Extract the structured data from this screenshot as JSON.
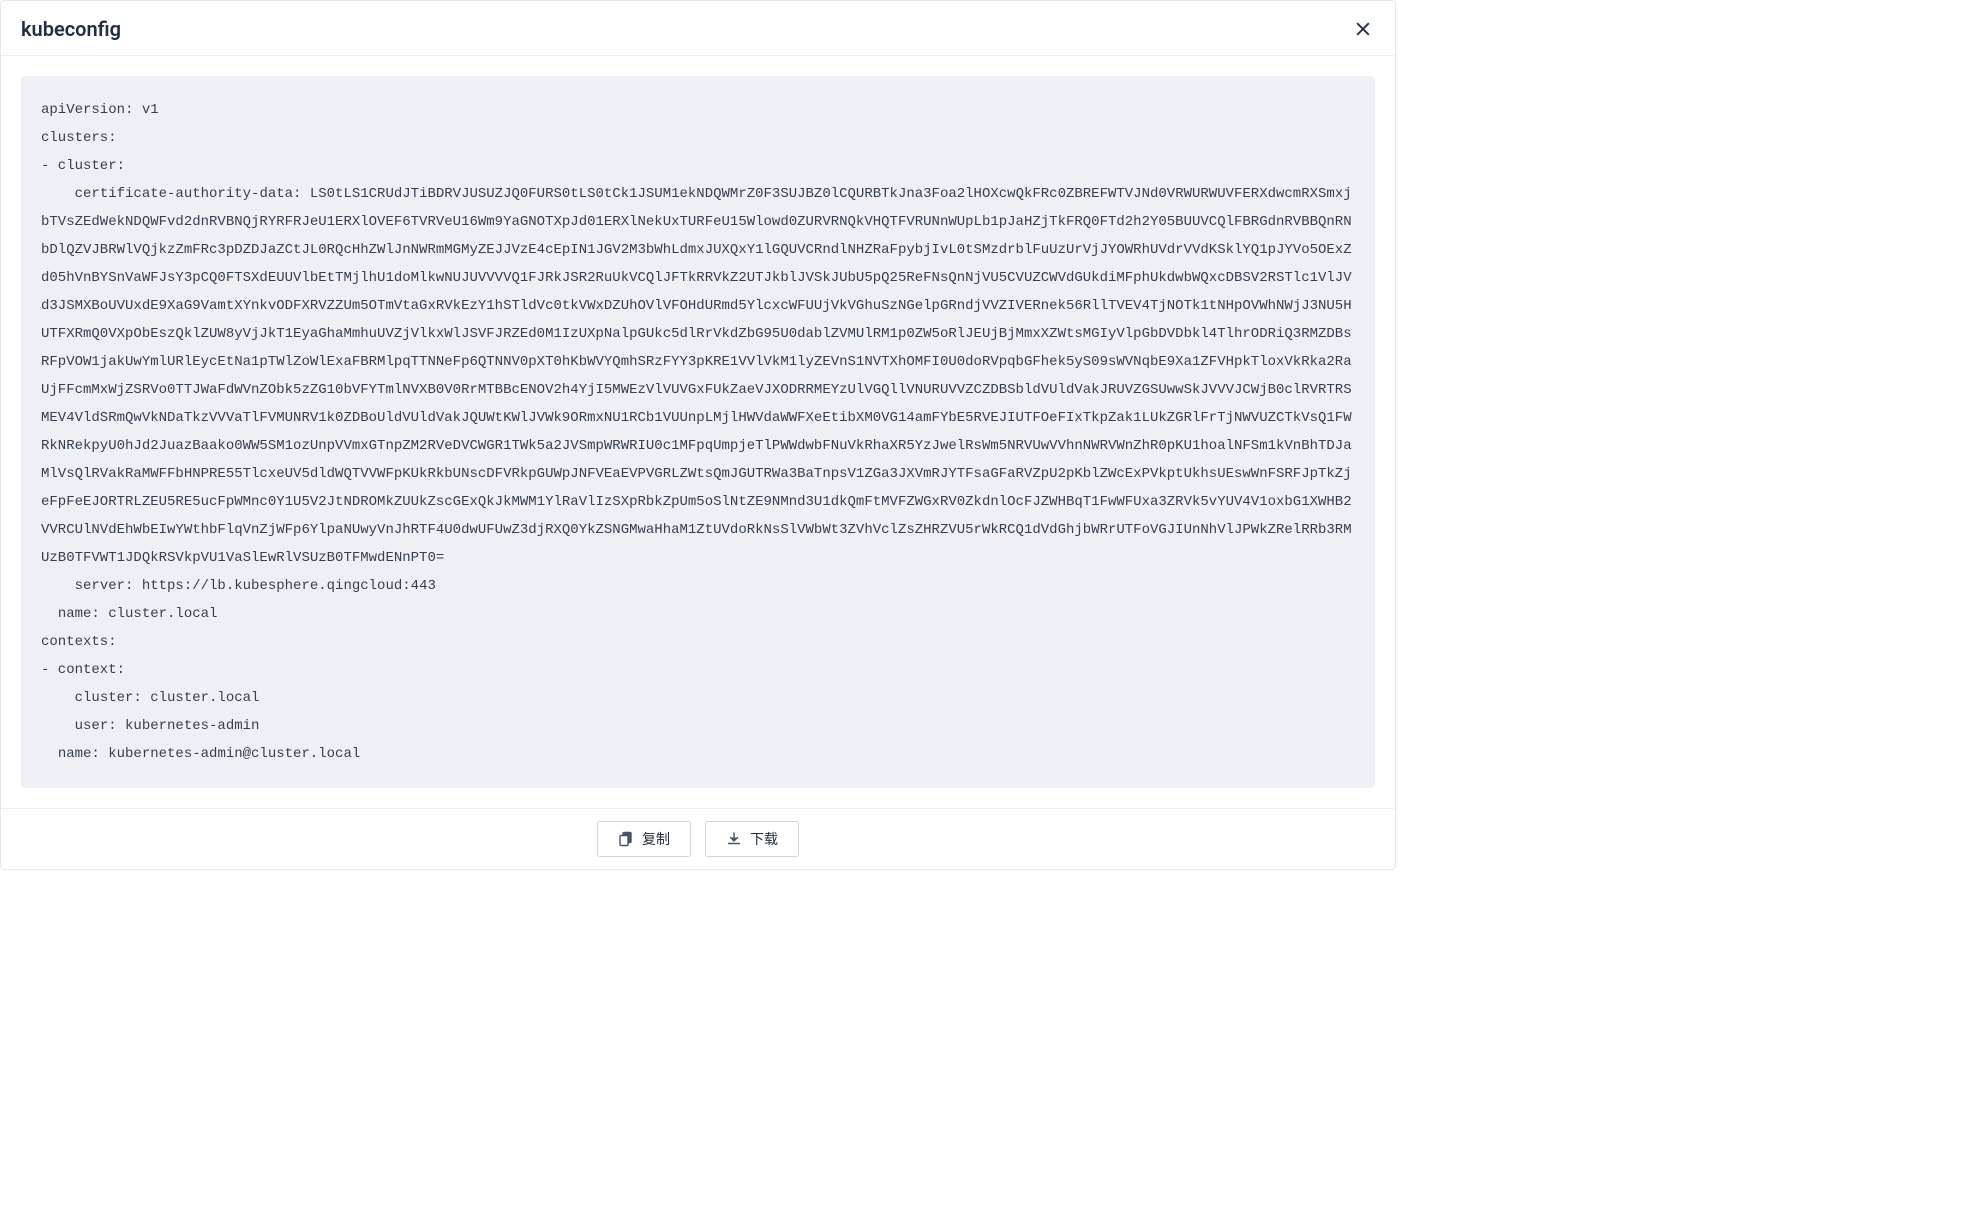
{
  "modal": {
    "title": "kubeconfig",
    "code": "apiVersion: v1\nclusters:\n- cluster:\n    certificate-authority-data: LS0tLS1CRUdJTiBDRVJUSUZJQ0FURS0tLS0tCk1JSUM1ekNDQWMrZ0F3SUJBZ0lCQURBTkJna3Foa2lHOXcwQkFRc0ZBREFWTVJNd0VRWURWUVFERXdwcmRXSmxjbTVsZEdWekNDQWFvd2dnRVBNQjRYRFRJeU1ERXlOVEF6TVRVeU16Wm9YaGNOTXpJd01ERXlNekUxTURFeU15Wlowd0ZURVRNQkVHQTFVRUNnWUpLb1pJaHZjTkFRQ0FTd2h2Y05BUUVCQlFBRGdnRVBBQnRNbDlQZVJBRWlVQjkzZmFRc3pDZDJaZCtJL0RQcHhZWlJnNWRmMGMyZEJJVzE4cEpIN1JGV2M3bWhLdmxJUXQxY1lGQUVCRndlNHZRaFpybjIvL0tSMzdrblFuUzUrVjJYOWRhUVdrVVdKSklYQ1pJYVo5OExZd05hVnBYSnVaWFJsY3pCQ0FTSXdEUUVlbEtTMjlhU1doMlkwNUJUVVVVQ1FJRkJSR2RuUkVCQlJFTkRRVkZ2UTJkblJVSkJUbU5pQ25ReFNsQnNjVU5CVUZCWVdGUkdiMFphUkdwbWQxcDBSV2RSTlc1VlJVd3JSMXBoUVUxdE9XaG9VamtXYnkvODFXRVZZUm5OTmVtaGxRVkEzY1hSTldVc0tkVWxDZUhOVlVFOHdURmd5YlcxcWFUUjVkVGhuSzNGelpGRndjVVZIVERnek56RllTVEV4TjNOTk1tNHpOVWhNWjJ3NU5HUTFXRmQ0VXpObEszQklZUW8yVjJkT1EyaGhaMmhuUVZjVlkxWlJSVFJRZEd0M1IzUXpNalpGUkc5dlRrVkdZbG95U0dablZVMUlRM1p0ZW5oRlJEUjBjMmxXZWtsMGIyVlpGbDVDbkl4TlhrODRiQ3RMZDBsRFpVOW1jakUwYmlURlEycEtNa1pTWlZoWlExaFBRMlpqTTNNeFp6QTNNV0pXT0hKbWVYQmhSRzFYY3pKRE1VVlVkM1lyZEVnS1NVTXhOMFI0U0doRVpqbGFhek5yS09sWVNqbE9Xa1ZFVHpkTloxVkRka2RaUjFFcmMxWjZSRVo0TTJWaFdWVnZObk5zZG10bVFYTmlNVXB0V0RrMTBBcENOV2h4YjI5MWEzVlVUVGxFUkZaeVJXODRRMEYzUlVGQllVNURUVVZCZDBSbldVUldVakJRUVZGSUwwSkJVVVJCWjB0clRVRTRSMEV4VldSRmQwVkNDaTkzVVVaTlFVMUNRV1k0ZDBoUldVUldVakJQUWtKWlJVWk9ORmxNU1RCb1VUUnpLMjlHWVdaWWFXeEtibXM0VG14amFYbE5RVEJIUTFOeFIxTkpZak1LUkZGRlFrTjNWVUZCTkVsQ1FWRkNRekpyU0hJd2JuazBaako0WW5SM1ozUnpVVmxGTnpZM2RVeDVCWGR1TWk5a2JVSmpWRWRIU0c1MFpqUmpjeTlPWWdwbFNuVkRhaXR5YzJwelRsWm5NRVUwVVhnNWRVWnZhR0pKU1hoalNFSm1kVnBhTDJaMlVsQlRVakRaMWFFbHNPRE55TlcxeUV5dldWQTVVWFpKUkRkbUNscDFVRkpGUWpJNFVEaEVPVGRLZWtsQmJGUTRWa3BaTnpsV1ZGa3JXVmRJYTFsaGFaRVZpU2pKblZWcExPVkptUkhsUEswWnFSRFJpTkZjeFpFeEJORTRLZEU5RE5ucFpWMnc0Y1U5V2JtNDROMkZUUkZscGExQkJkMWM1YlRaVlIzSXpRbkZpUm5oSlNtZE9NMnd3U1dkQmFtMVFZWGxRV0ZkdnlOcFJZWHBqT1FwWFUxa3ZRVk5vYUV4V1oxbG1XWHB2VVRCUlNVdEhWbEIwYWthbFlqVnZjWFp6YlpaNUwyVnJhRTF4U0dwUFUwZ3djRXQ0YkZSNGMwaHhaM1ZtUVdoRkNsSlVWbWt3ZVhVclZsZHRZVU5rWkRCQ1dVdGhjbWRrUTFoVGJIUnNhVlJPWkZRelRRb3RMUzB0TFVWT1JDQkRSVkpVU1VaSlEwRlVSUzB0TFMwdENnPT0=\n    server: https://lb.kubesphere.qingcloud:443\n  name: cluster.local\ncontexts:\n- context:\n    cluster: cluster.local\n    user: kubernetes-admin\n  name: kubernetes-admin@cluster.local"
  },
  "footer": {
    "copy_label": "复制",
    "download_label": "下载"
  }
}
